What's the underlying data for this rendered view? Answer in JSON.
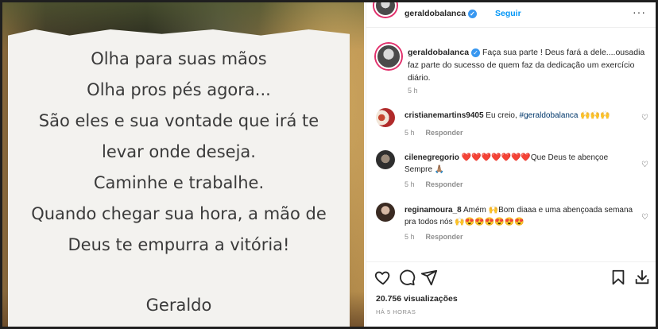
{
  "post": {
    "quote_lines": [
      "Olha para suas mãos",
      "Olha pros pés agora...",
      "São eles e sua vontade que irá te",
      "levar onde deseja.",
      "Caminhe e trabalhe.",
      "Quando chegar sua hora, a mão de",
      "Deus te empurra a vitória!"
    ],
    "signature": "Geraldo"
  },
  "header": {
    "username": "geraldobalanca",
    "follow_label": "Seguir",
    "more_label": "···"
  },
  "caption": {
    "username": "geraldobalanca",
    "text": "Faça sua parte ! Deus fará a dele....ousadia faz parte do sucesso de quem faz da dedicação um exercício diário.",
    "age": "5 h"
  },
  "comments": [
    {
      "username": "cristianemartins9405",
      "text": "Eu creio, ",
      "tag": "#geraldobalanca",
      "emoji": "🙌🙌🙌",
      "age": "5 h",
      "reply_label": "Responder"
    },
    {
      "username": "cilenegregorio",
      "text_before": "",
      "emoji": "❤️❤️❤️❤️❤️❤️❤️",
      "text": "Que Deus te abençoe Sempre",
      "emoji_after": "🙏🏽",
      "age": "5 h",
      "reply_label": "Responder"
    },
    {
      "username": "reginamoura_8",
      "text": "Amém",
      "emoji_mid": "🙌",
      "text2": "Bom diaaa e uma abençoada semana pra todos nós",
      "emoji_after": "🙌😍😍😍😍😍😍",
      "age": "5 h",
      "reply_label": "Responder"
    }
  ],
  "actions": {
    "likes_text": "20.756 visualizações",
    "time_text": "HÁ 5 HORAS"
  },
  "colors": {
    "accent": "#0095f6",
    "verified": "#3897f0",
    "muted": "#8e8e8e"
  }
}
